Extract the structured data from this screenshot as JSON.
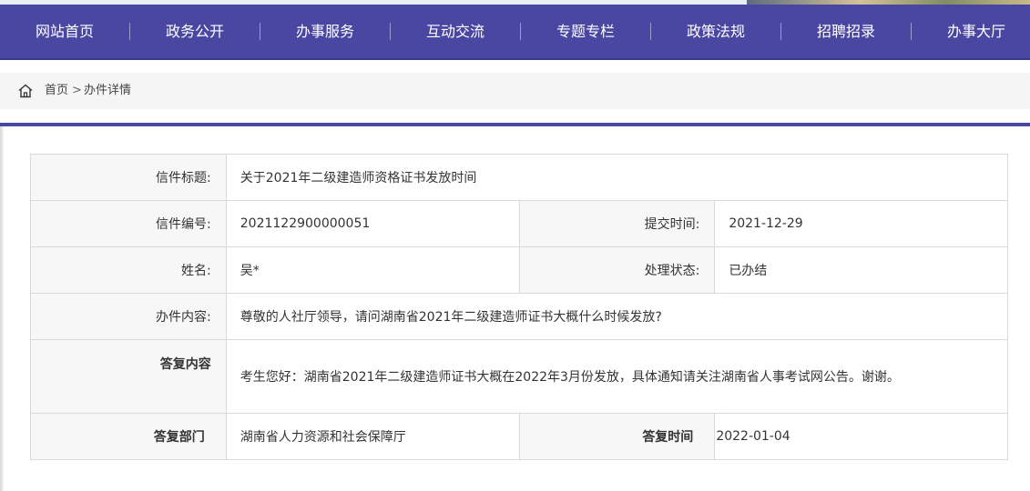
{
  "nav": {
    "items": [
      "网站首页",
      "政务公开",
      "办事服务",
      "互动交流",
      "专题专栏",
      "政策法规",
      "招聘招录",
      "办事大厅"
    ]
  },
  "breadcrumb": {
    "home": "首页",
    "separator": ">",
    "current": "办件详情"
  },
  "detail": {
    "title_label": "信件标题:",
    "title_value": "关于2021年二级建造师资格证书发放时间",
    "number_label": "信件编号:",
    "number_value": "2021122900000051",
    "submit_time_label": "提交时间:",
    "submit_time_value": "2021-12-29",
    "name_label": "姓名:",
    "name_value": "吴*",
    "status_label": "处理状态:",
    "status_value": "已办结",
    "content_label": "办件内容:",
    "content_value": "尊敬的人社厅领导，请问湖南省2021年二级建造师证书大概什么时候发放?",
    "reply_label": "答复内容",
    "reply_value": "考生您好：湖南省2021年二级建造师证书大概在2022年3月份发放，具体通知请关注湖南省人事考试网公告。谢谢。",
    "dept_label": "答复部门",
    "dept_value": "湖南省人力资源和社会保障厅",
    "reply_time_label": "答复时间",
    "reply_time_value": "2022-01-04"
  },
  "colors": {
    "nav_bg": "#4a47a3",
    "label_bg": "#f7f7f7",
    "border": "#d9d9d9"
  },
  "icons": {
    "home": "home-icon"
  }
}
